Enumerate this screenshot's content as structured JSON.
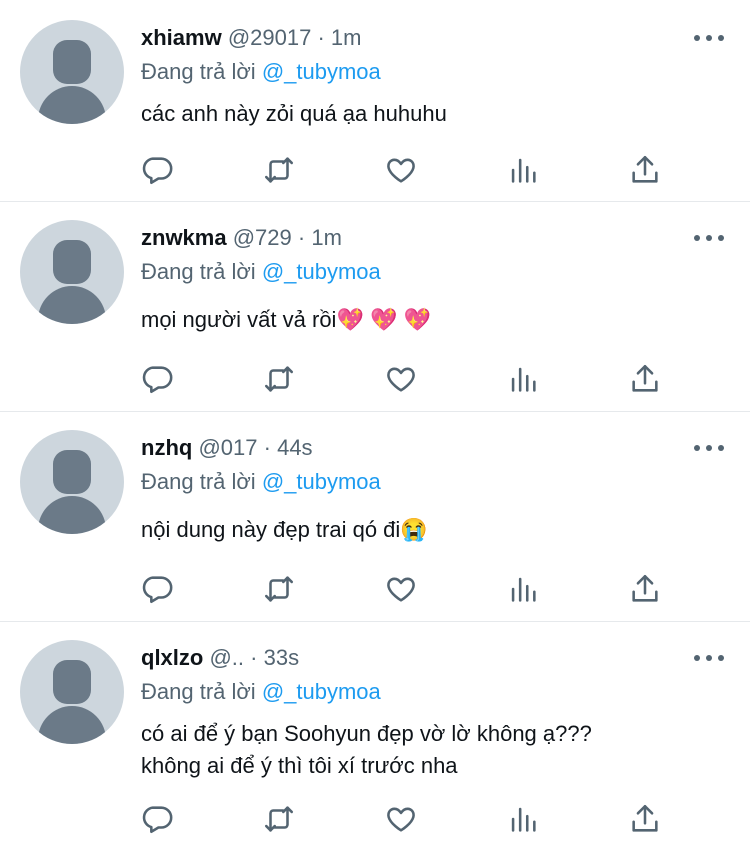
{
  "tweets": [
    {
      "name": "xhiamw",
      "handle": "@29017",
      "sep": "·",
      "time": "1m",
      "replying_prefix": "Đang trả lời",
      "mention": "@_tubymoa",
      "lines": [
        "các anh này zỏi quá ạa huhuhu"
      ]
    },
    {
      "name": "znwkma",
      "handle": "@729",
      "sep": "·",
      "time": "1m",
      "replying_prefix": "Đang trả lời",
      "mention": "@_tubymoa",
      "lines": [
        "mọi người vất vả rồi💖 💖 💖"
      ]
    },
    {
      "name": "nzhq",
      "handle": "@017",
      "sep": "·",
      "time": "44s",
      "replying_prefix": "Đang trả lời",
      "mention": "@_tubymoa",
      "lines": [
        "nội dung này đẹp trai qó đi😭"
      ]
    },
    {
      "name": "qlxlzo",
      "handle": "@..",
      "sep": "·",
      "time": "33s",
      "replying_prefix": "Đang trả lời",
      "mention": "@_tubymoa",
      "lines": [
        "có ai để ý bạn Soohyun đẹp vờ lờ không ạ???",
        "không ai để ý thì tôi xí trước nha"
      ]
    }
  ],
  "icons": {
    "reply": "reply-icon",
    "retweet": "retweet-icon",
    "like": "like-icon",
    "views": "views-icon",
    "share": "share-icon",
    "more": "more-icon"
  },
  "colors": {
    "text": "#0f1419",
    "secondary": "#536471",
    "mention": "#1d9bf0",
    "divider": "#e6e9ec",
    "avatar_bg": "#cdd6dd",
    "avatar_fg": "#6b7a88"
  }
}
